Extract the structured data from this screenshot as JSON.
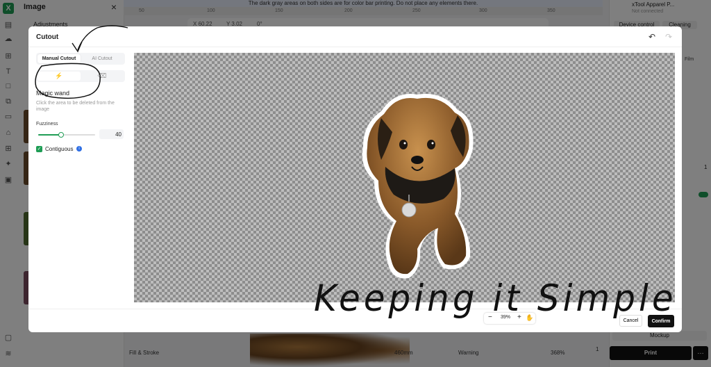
{
  "background": {
    "left_panel": {
      "title": "Image",
      "adjustments_label": "Adjustments"
    },
    "banner_text": "The dark gray areas on both sides are for color bar printing. Do not place any elements there.",
    "ruler_ticks": [
      "50",
      "100",
      "150",
      "200",
      "250",
      "300",
      "350"
    ],
    "toolbar": {
      "x": "60.22",
      "y": "3.02",
      "rotation": "0°"
    },
    "device": {
      "name": "xTool Apparel P...",
      "status": "Not connected",
      "tab_control": "Device control",
      "tab_cleaning": "Cleaning",
      "film_label": "Film",
      "count": "1"
    },
    "statusbar": {
      "panel": "Fill & Stroke",
      "width": "460mm",
      "warning": "Warning",
      "zoom": "368%",
      "badge": "1"
    },
    "mockup_label": "Mockup",
    "print_label": "Print",
    "more_label": "…"
  },
  "modal": {
    "title": "Cutout",
    "tabs": [
      {
        "label": "Manual Cutout",
        "active": true
      },
      {
        "label": "AI Cutout",
        "active": false
      }
    ],
    "modes": [
      {
        "icon": "magic-wand-icon",
        "active": true
      },
      {
        "icon": "eraser-icon",
        "active": false
      }
    ],
    "tool_name": "Magic wand",
    "tool_description": "Click the area to be deleted from the image",
    "fuzziness": {
      "label": "Fuzziness",
      "value": 40,
      "slider_fraction": 0.4
    },
    "contiguous": {
      "label": "Contiguous",
      "checked": true
    },
    "zoom": {
      "value": "39%"
    },
    "buttons": {
      "cancel": "Cancel",
      "confirm": "Confirm"
    }
  },
  "annotation": {
    "text": "Keeping it Simple"
  }
}
